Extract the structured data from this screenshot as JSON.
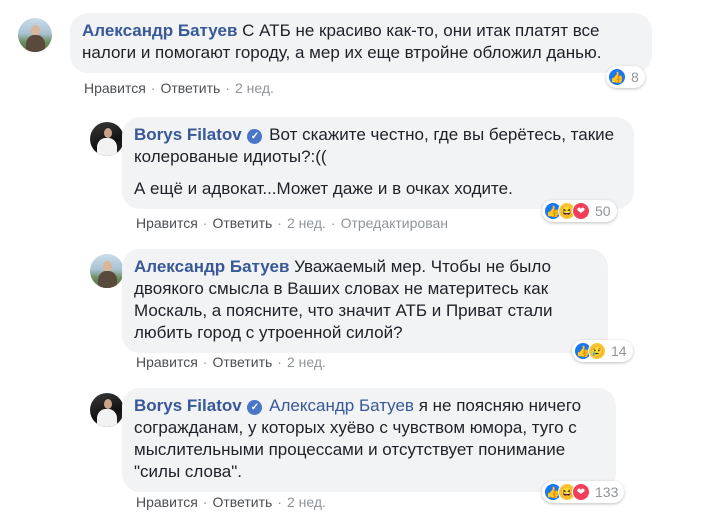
{
  "comments": [
    {
      "author": "Александр Батуев",
      "text": "С АТБ не красиво как-то, они итак платят все налоги и помогают городу, а мер их еще втройне обложил данью.",
      "like_label": "Нравится",
      "reply_label": "Ответить",
      "time": "2 нед.",
      "reaction_count": "8",
      "reactions": [
        "like-icon"
      ]
    },
    {
      "author": "Borys Filatov",
      "verified": true,
      "text": "Вот скажите честно, где вы берётесь, такие колерованые идиоты?:((",
      "text2": "А ещё и адвокат...Может даже и в очках ходите.",
      "like_label": "Нравится",
      "reply_label": "Ответить",
      "time": "2 нед.",
      "edited": "Отредактирован",
      "reaction_count": "50",
      "reactions": [
        "like-icon",
        "haha-icon",
        "love-icon"
      ]
    },
    {
      "author": "Александр Батуев",
      "text": "Уважаемый мер. Чтобы не было двоякого смысла в Ваших словах не материтесь как Москаль, а поясните, что значит АТБ и Приват стали любить город с утроенной силой?",
      "like_label": "Нравится",
      "reply_label": "Ответить",
      "time": "2 нед.",
      "reaction_count": "14",
      "reactions": [
        "like-icon",
        "sad-icon"
      ]
    },
    {
      "author": "Borys Filatov",
      "verified": true,
      "mention": "Александр Батуев",
      "text": "я не поясняю ничего согражданам, у которых хуёво с чувством юмора, туго с мыслительными процессами и отсутствует понимание \"силы слова\".",
      "like_label": "Нравится",
      "reply_label": "Ответить",
      "time": "2 нед.",
      "reaction_count": "133",
      "reactions": [
        "like-icon",
        "haha-icon",
        "love-icon"
      ]
    }
  ],
  "colors": {
    "link": "#385898",
    "bubble": "#f2f3f5",
    "meta": "#90949c",
    "like": "#1877f2"
  }
}
